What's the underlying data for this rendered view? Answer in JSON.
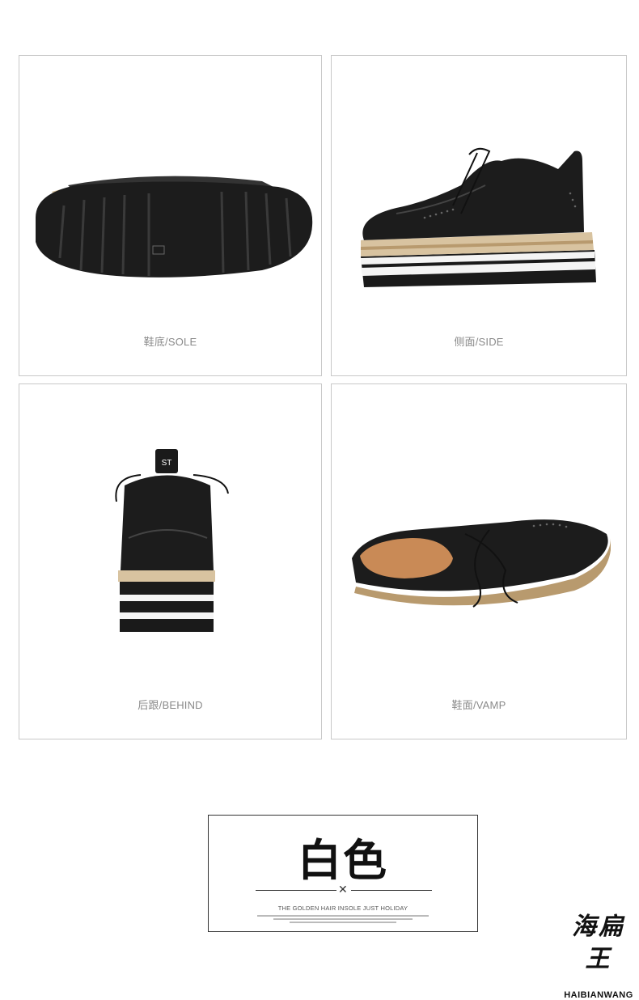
{
  "panels": [
    {
      "caption": "鞋底/SOLE"
    },
    {
      "caption": "侧面/SIDE"
    },
    {
      "caption": "后跟/BEHIND"
    },
    {
      "caption": "鞋面/VAMP"
    }
  ],
  "color_label": {
    "title": "白色",
    "tagline": "THE GOLDEN HAIR INSOLE JUST HOLIDAY"
  },
  "logo": {
    "cn": "海扁王",
    "en": "HAIBIANWANG"
  },
  "colors": {
    "shoe_black": "#1a1a1a",
    "sole_white": "#f4f4f4",
    "jute": "#d8c3a0",
    "border": "#c8c8c8"
  }
}
